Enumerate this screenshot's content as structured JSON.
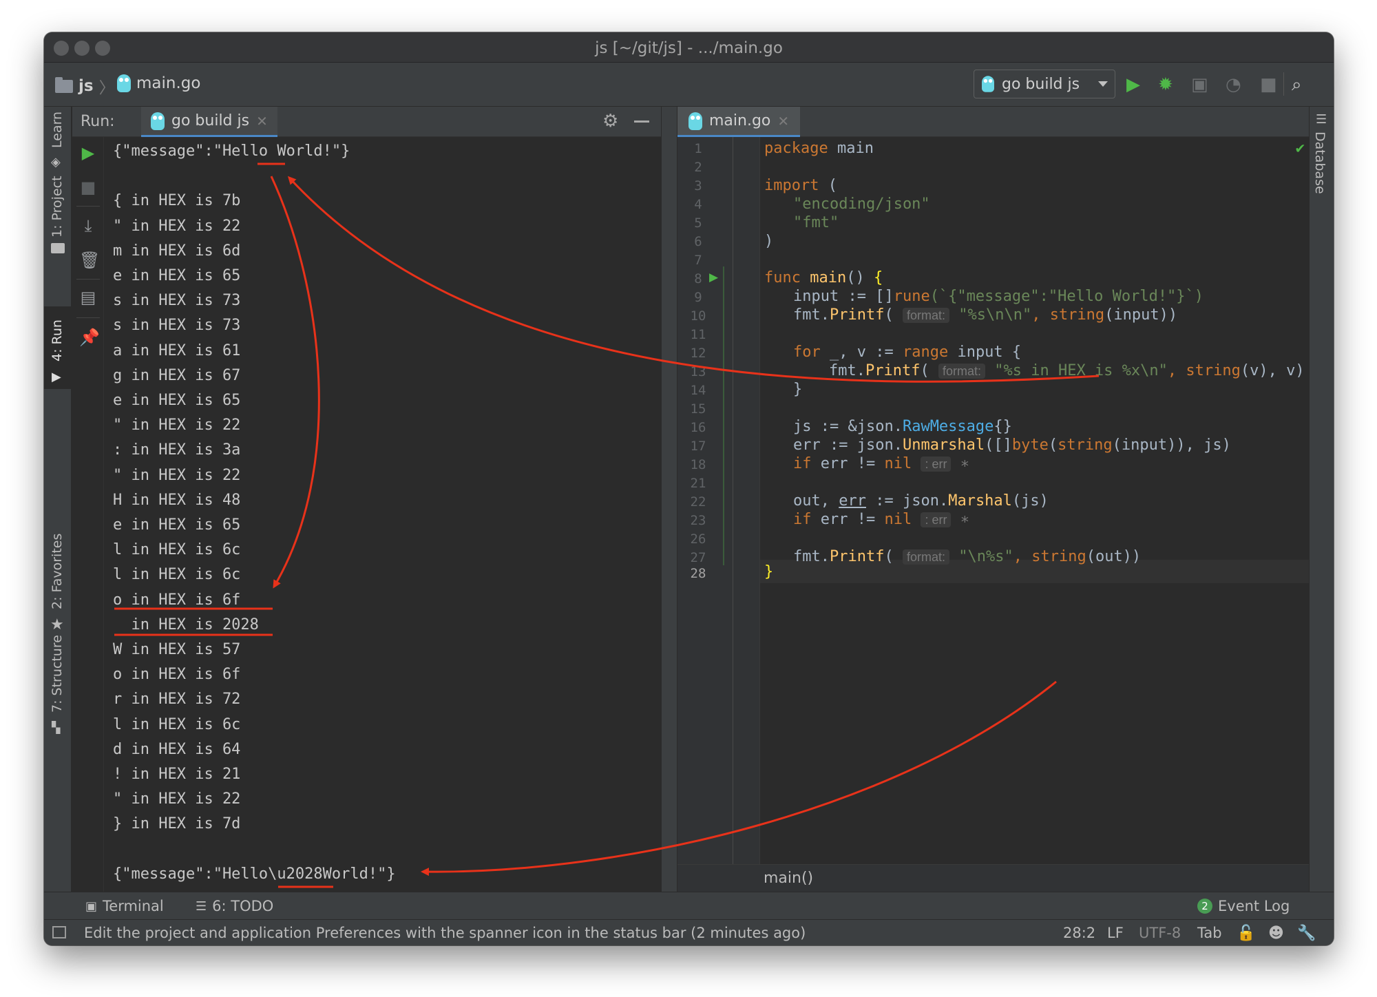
{
  "window": {
    "title": "js [~/git/js] - .../main.go"
  },
  "navbar": {
    "project": "js",
    "file": "main.go",
    "run_config": "go build js"
  },
  "tool_windows": {
    "left": [
      "Learn",
      "1: Project",
      "4: Run",
      "2: Favorites",
      "7: Structure"
    ],
    "right": [
      "Database"
    ]
  },
  "run_panel": {
    "label": "Run:",
    "tab": "go build js",
    "console": [
      "{\"message\":\"Hello World!\"}",
      "",
      "{ in HEX is 7b",
      "\" in HEX is 22",
      "m in HEX is 6d",
      "e in HEX is 65",
      "s in HEX is 73",
      "s in HEX is 73",
      "a in HEX is 61",
      "g in HEX is 67",
      "e in HEX is 65",
      "\" in HEX is 22",
      ": in HEX is 3a",
      "\" in HEX is 22",
      "H in HEX is 48",
      "e in HEX is 65",
      "l in HEX is 6c",
      "l in HEX is 6c",
      "o in HEX is 6f",
      "  in HEX is 2028",
      "W in HEX is 57",
      "o in HEX is 6f",
      "r in HEX is 72",
      "l in HEX is 6c",
      "d in HEX is 64",
      "! in HEX is 21",
      "\" in HEX is 22",
      "} in HEX is 7d",
      "",
      "{\"message\":\"Hello\\u2028World!\"}"
    ]
  },
  "editor": {
    "tab": "main.go",
    "line_numbers": [
      "1",
      "2",
      "3",
      "4",
      "5",
      "6",
      "7",
      "8",
      "9",
      "10",
      "11",
      "12",
      "13",
      "14",
      "15",
      "16",
      "17",
      "18",
      "21",
      "22",
      "23",
      "26",
      "27",
      "28"
    ],
    "code": {
      "l1_kw": "package",
      "l1_rest": " main",
      "l3_kw": "import",
      "l3_rest": " (",
      "l4": "\"encoding/json\"",
      "l5": "\"fmt\"",
      "l6": ")",
      "l8_kw": "func",
      "l8_fn": "main",
      "l8_rest": "() ",
      "l8_brace": "{",
      "l9_a": "input := []",
      "l9_kw": "rune",
      "l9_str": "(`{\"message\":\"Hello World!\"}`)",
      "l10_a": "fmt.",
      "l10_fn": "Printf",
      "l10_p": "( ",
      "l10_hint": "format:",
      "l10_str": "\"%s\\n\\n\"",
      "l10_c": ", ",
      "l10_kw": "string",
      "l10_e": "(input))",
      "l12_kw": "for",
      "l12_a": " _, v := ",
      "l12_kw2": "range",
      "l12_b": " input {",
      "l13_a": "fmt.",
      "l13_fn": "Printf",
      "l13_p": "( ",
      "l13_hint": "format:",
      "l13_str": "\"%s in HEX is %x\\n\"",
      "l13_c": ", ",
      "l13_kw": "string",
      "l13_e": "(v), v)",
      "l14": "}",
      "l16_a": "js := &json.",
      "l16_tp": "RawMessage",
      "l16_b": "{}",
      "l17_a": "err := json.",
      "l17_fn": "Unmarshal",
      "l17_b": "([]",
      "l17_kw": "byte",
      "l17_c": "(",
      "l17_kw2": "string",
      "l17_d": "(input)), js)",
      "l18_kw": "if",
      "l18_a": " err != ",
      "l18_kw2": "nil",
      "l18_hint": ": err",
      "l22_a": "out, ",
      "l22_err": "err",
      "l22_b": " := json.",
      "l22_fn": "Marshal",
      "l22_c": "(js)",
      "l23_kw": "if",
      "l23_a": " err != ",
      "l23_kw2": "nil",
      "l23_hint": ": err",
      "l27_a": "fmt.",
      "l27_fn": "Printf",
      "l27_p": "( ",
      "l27_hint": "format:",
      "l27_str": "\"\\n%s\"",
      "l27_c": ", ",
      "l27_kw": "string",
      "l27_e": "(out))",
      "l28": "}"
    },
    "breadcrumb": "main()"
  },
  "bottom_tools": {
    "terminal": "Terminal",
    "todo": "6: TODO",
    "event_log": "Event Log",
    "event_count": "2"
  },
  "status": {
    "message": "Edit the project and application Preferences with the spanner icon in the status bar (2 minutes ago)",
    "position": "28:2",
    "line_sep": "LF",
    "encoding": "UTF-8",
    "indent": "Tab"
  },
  "colors": {
    "annotation": "#e8321a",
    "run_green": "#4fb848",
    "tab_accent": "#4a88c7"
  }
}
